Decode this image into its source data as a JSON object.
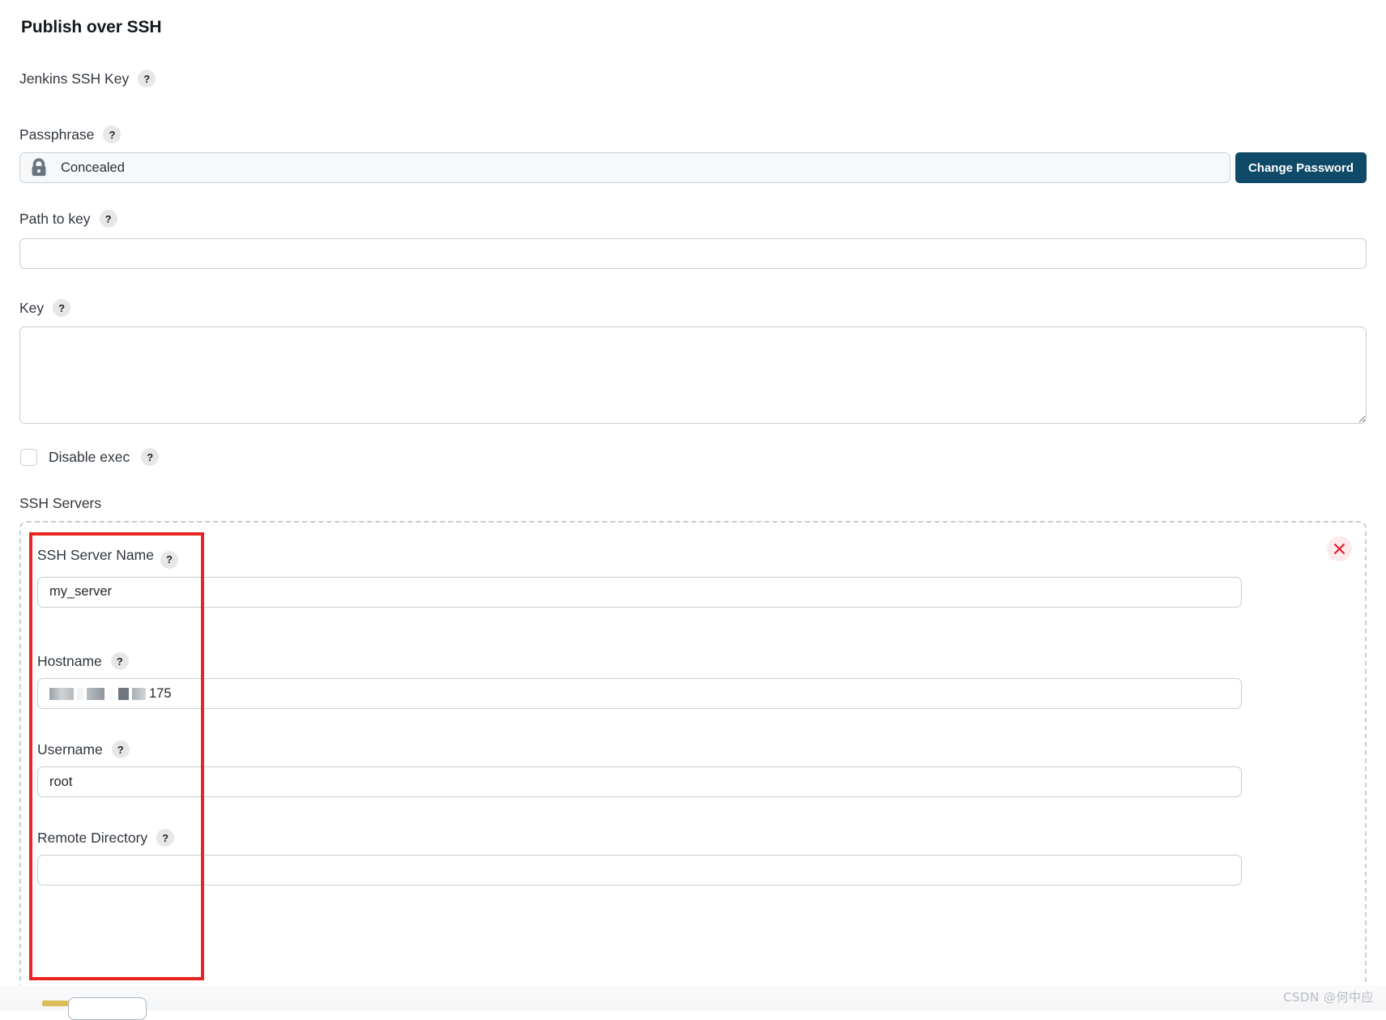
{
  "page": {
    "title": "Publish over SSH"
  },
  "help_icon_glyph": "?",
  "help_icon_name": "help-question-icon",
  "fields": {
    "jenkins_ssh_key": {
      "label": "Jenkins SSH Key"
    },
    "passphrase": {
      "label": "Passphrase",
      "value": "Concealed",
      "lock_icon": "lock-icon",
      "change_password_button": "Change Password"
    },
    "path_to_key": {
      "label": "Path to key",
      "value": "",
      "placeholder": ""
    },
    "key": {
      "label": "Key",
      "value": "",
      "placeholder": ""
    },
    "disable_exec": {
      "label": "Disable exec",
      "checked": false
    }
  },
  "ssh_servers": {
    "label": "SSH Servers",
    "remove_icon": "close-x-icon",
    "entries": [
      {
        "name_label": "SSH Server Name",
        "name_value": "my_server",
        "hostname_label": "Hostname",
        "hostname_value_visible": "175",
        "hostname_redacted": true,
        "username_label": "Username",
        "username_value": "root",
        "remote_directory_label": "Remote Directory",
        "remote_directory_value": ""
      }
    ]
  },
  "colors": {
    "accent_button": "#0f4a68",
    "annotation": "#e8251f",
    "remove_badge_bg": "#fdeaec",
    "input_border": "#c3ced6",
    "help_badge_bg": "#e7e7e8"
  },
  "watermark": {
    "text": "CSDN @何中应"
  }
}
